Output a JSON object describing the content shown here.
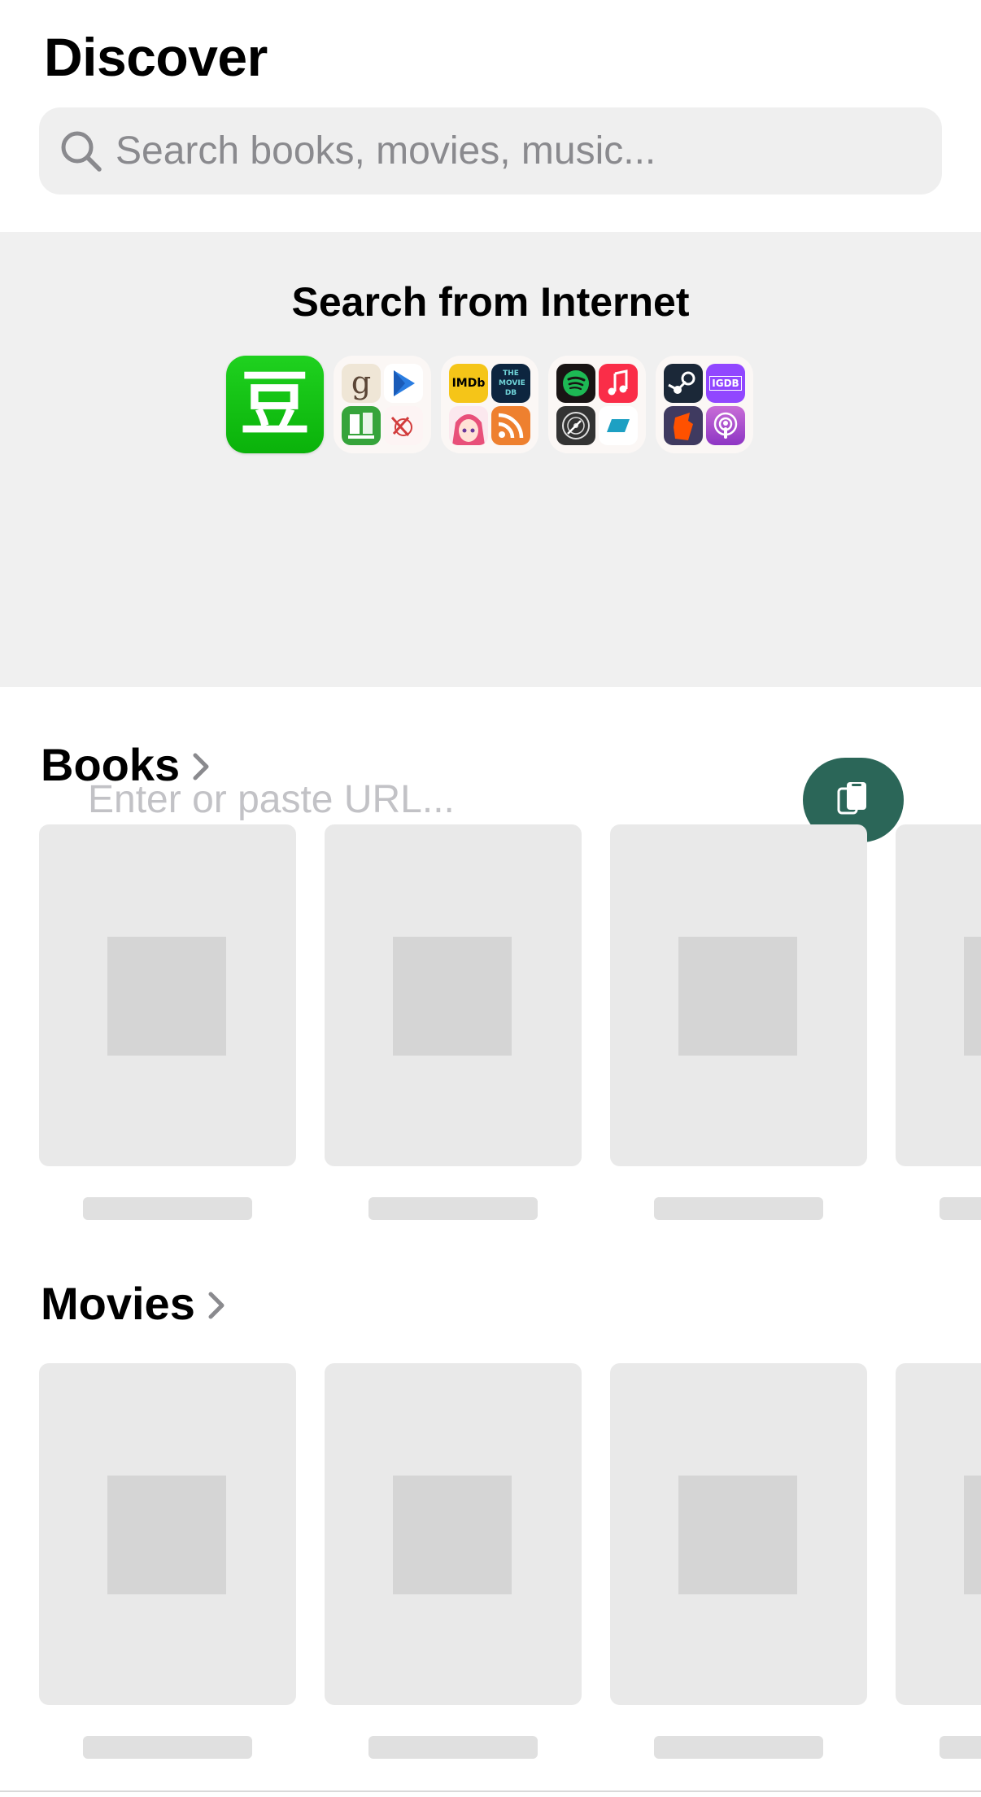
{
  "header": {
    "title": "Discover"
  },
  "search": {
    "placeholder": "Search books, movies, music..."
  },
  "internet": {
    "title": "Search from Internet",
    "providers": [
      {
        "name": "douban-icon",
        "glyph": "豆",
        "color": "#13c313"
      },
      {
        "name": "goodreads-icon",
        "glyph": "g"
      },
      {
        "name": "google-books-icon"
      },
      {
        "name": "books-tw-icon"
      },
      {
        "name": "bangumi-icon"
      },
      {
        "name": "imdb-icon",
        "glyph": "IMDb",
        "color": "#f5c518"
      },
      {
        "name": "tmdb-icon",
        "glyph": "THE MOVIE DB",
        "color": "#0d253f"
      },
      {
        "name": "anime-icon"
      },
      {
        "name": "rss-icon",
        "color": "#ee802f"
      },
      {
        "name": "spotify-icon",
        "color": "#1db954"
      },
      {
        "name": "apple-music-icon",
        "color": "#fa2d48"
      },
      {
        "name": "discogs-icon"
      },
      {
        "name": "bandcamp-icon",
        "color": "#1da0c3"
      },
      {
        "name": "steam-icon",
        "color": "#1b2838"
      },
      {
        "name": "igdb-icon",
        "glyph": "IGDB",
        "color": "#9147ff"
      },
      {
        "name": "bgg-icon",
        "color": "#ff5100"
      },
      {
        "name": "apple-podcasts-icon",
        "color": "#9933cc"
      }
    ],
    "url_placeholder": "Enter or paste URL...",
    "paste_color": "#2b6658"
  },
  "sections": [
    {
      "title": "Books"
    },
    {
      "title": "Movies"
    }
  ]
}
